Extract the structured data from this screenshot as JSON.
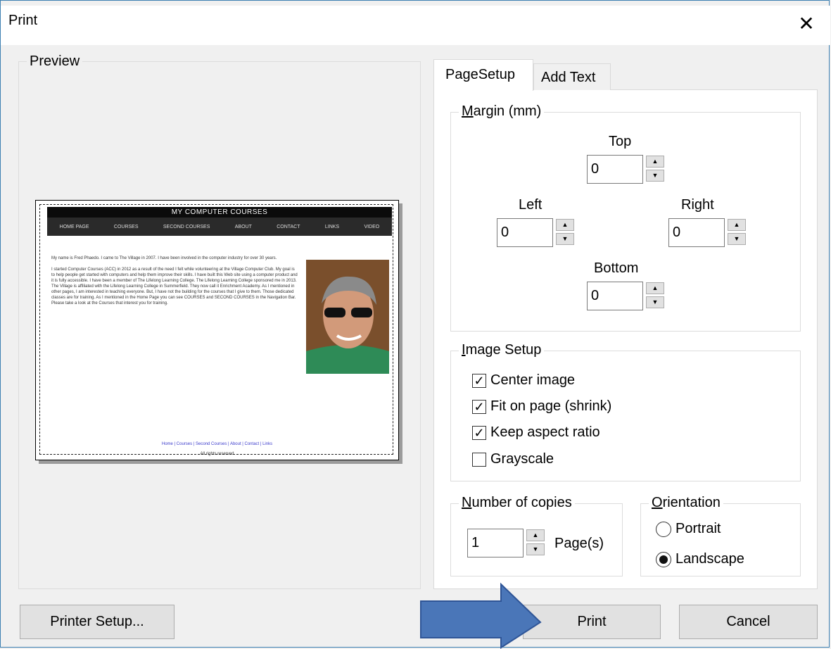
{
  "window": {
    "title": "Print",
    "close_glyph": "✕"
  },
  "preview": {
    "legend": "Preview",
    "page": {
      "site_title": "MY COMPUTER COURSES",
      "nav": [
        "HOME PAGE",
        "COURSES",
        "SECOND COURSES",
        "ABOUT",
        "CONTACT",
        "LINKS",
        "VIDEO"
      ],
      "paragraphs": [
        "My name is Fred Phaedo. I came to The Village in 2007. I have been involved in the computer industry for over 30 years.",
        "I started Computer Courses (ACC) in 2012 as a result of the need I felt while volunteering at the Village Computer Club. My goal is to help people get started with computers and help them improve their skills. I have built this Web site using a computer product and it is fully accessible. I have been a member of The Lifelong Learning College. The Lifelong Learning College sponsored me in 2013. The Village is affiliated with the Lifelong Learning College in Summerfield. They now call it Enrichment Academy. As I mentioned in other pages, I am interested in teaching everyone. But, I have not the building for the courses that I give to them. Those dedicated classes are for training. As I mentioned in the Home Page you can see COURSES and SECOND COURSES in the Navigation Bar. Please take a look at the Courses that interest you for training."
      ],
      "footer_links": "Home | Courses | Second Courses | About | Contact | Links",
      "footer": "All rights reserved"
    }
  },
  "tabs": [
    {
      "label": "PageSetup",
      "active": true
    },
    {
      "label": "Add Text",
      "active": false
    }
  ],
  "margin": {
    "legend_pre": "",
    "legend_ul": "M",
    "legend_post": "argin (mm)",
    "top_label": "Top",
    "top_value": "0",
    "left_label": "Left",
    "left_value": "0",
    "right_label": "Right",
    "right_value": "0",
    "bottom_label": "Bottom",
    "bottom_value": "0"
  },
  "image_setup": {
    "legend_ul": "I",
    "legend_post": "mage Setup",
    "options": [
      {
        "label": "Center image",
        "checked": true
      },
      {
        "label": "Fit on page (shrink)",
        "checked": true
      },
      {
        "label": "Keep aspect ratio",
        "checked": true
      },
      {
        "label": "Grayscale",
        "checked": false
      }
    ]
  },
  "copies": {
    "legend_ul": "N",
    "legend_post": "umber of copies",
    "value": "1",
    "unit": "Page(s)"
  },
  "orientation": {
    "legend_ul": "O",
    "legend_post": "rientation",
    "portrait": "Portrait",
    "landscape": "Landscape",
    "selected": "Landscape"
  },
  "buttons": {
    "printer_setup": "Printer Setup...",
    "print": "Print",
    "cancel": "Cancel"
  },
  "spinner": {
    "up": "▲",
    "down": "▼"
  },
  "check_glyph": "✓",
  "colors": {
    "arrow_fill": "#4a76b8",
    "arrow_stroke": "#2f5597",
    "window_border": "#3c7fb1"
  }
}
